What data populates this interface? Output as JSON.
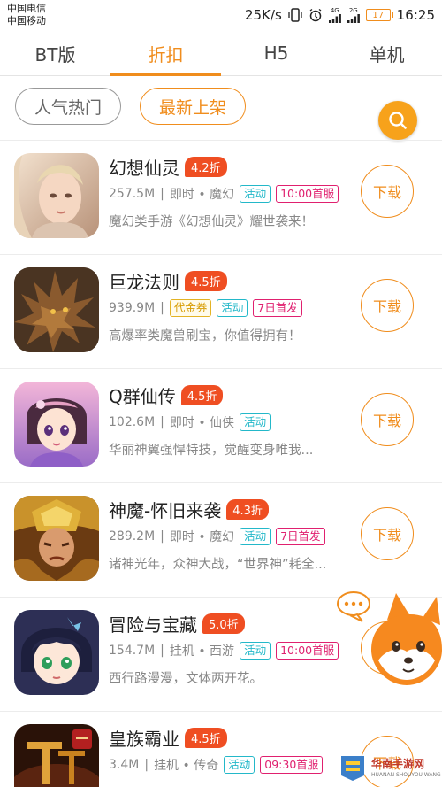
{
  "status_bar": {
    "carrier_1": "中国电信",
    "carrier_2": "中国移动",
    "speed": "25K/s",
    "signal_1": "4G",
    "signal_2": "2G",
    "battery": "17",
    "time": "16:25"
  },
  "tabs": [
    {
      "label": "BT版",
      "active": false
    },
    {
      "label": "折扣",
      "active": true
    },
    {
      "label": "H5",
      "active": false
    },
    {
      "label": "单机",
      "active": false
    }
  ],
  "filters": [
    {
      "label": "人气热门",
      "active": false
    },
    {
      "label": "最新上架",
      "active": true
    }
  ],
  "search_icon": "search-icon",
  "colors": {
    "accent": "#f08d1d",
    "discount": "#ef4e22",
    "tag_cyan": "#23b8c9",
    "tag_red": "#e0206f",
    "tag_yellow": "#d79b00"
  },
  "games": [
    {
      "name": "幻想仙灵",
      "discount": "4.2折",
      "size": "257.5M",
      "meta": "即时 • 魔幻",
      "tags": [
        {
          "text": "活动",
          "style": "cyan"
        },
        {
          "text": "10:00首服",
          "style": "red"
        }
      ],
      "desc": "魔幻类手游《幻想仙灵》耀世袭来！",
      "button": "下载"
    },
    {
      "name": "巨龙法则",
      "discount": "4.5折",
      "size": "939.9M",
      "meta": "",
      "tags": [
        {
          "text": "代金券",
          "style": "yellow"
        },
        {
          "text": "活动",
          "style": "cyan"
        },
        {
          "text": "7日首发",
          "style": "red"
        }
      ],
      "desc": "高爆率类魔兽刷宝，你值得拥有！",
      "button": "下载"
    },
    {
      "name": "Q群仙传",
      "discount": "4.5折",
      "size": "102.6M",
      "meta": "即时 • 仙侠",
      "tags": [
        {
          "text": "活动",
          "style": "cyan"
        }
      ],
      "desc": "华丽神翼强悍特技，觉醒变身唯我...",
      "button": "下载"
    },
    {
      "name": "神魔-怀旧来袭",
      "discount": "4.3折",
      "size": "289.2M",
      "meta": "即时 • 魔幻",
      "tags": [
        {
          "text": "活动",
          "style": "cyan"
        },
        {
          "text": "7日首发",
          "style": "red"
        }
      ],
      "desc": "诸神光年，众神大战，“世界神”耗全...",
      "button": "下载"
    },
    {
      "name": "冒险与宝藏",
      "discount": "5.0折",
      "size": "154.7M",
      "meta": "挂机 • 西游",
      "tags": [
        {
          "text": "活动",
          "style": "cyan"
        },
        {
          "text": "10:00首服",
          "style": "red"
        }
      ],
      "desc": "西行路漫漫，文体两开花。",
      "button": "下载"
    },
    {
      "name": "皇族霸业",
      "discount": "4.5折",
      "size": "3.4M",
      "meta": "挂机 • 传奇",
      "tags": [
        {
          "text": "活动",
          "style": "cyan"
        },
        {
          "text": "09:30首服",
          "style": "red"
        }
      ],
      "desc": "",
      "button": "下载"
    }
  ],
  "mascot": {
    "bubble": "•••"
  },
  "watermark": {
    "text": "华南手游网",
    "sub": "HUANAN SHOUYOU WANG"
  }
}
